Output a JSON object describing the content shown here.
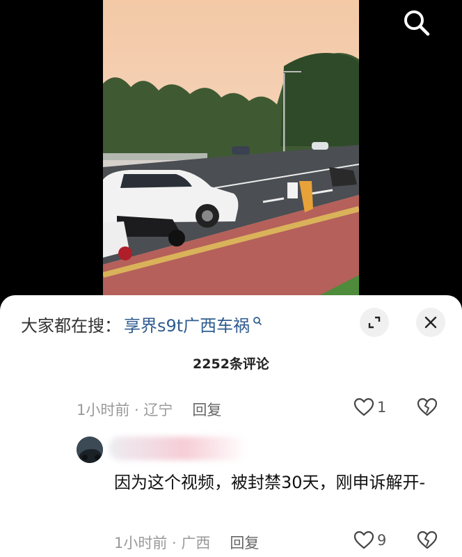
{
  "video": {
    "icons": {
      "search": "search-icon"
    }
  },
  "sheet": {
    "suggest_prefix": "大家都在搜：",
    "suggest_keyword": "享界s9t广西车祸",
    "comment_count": "2252条评论",
    "icons": {
      "expand": "expand-icon",
      "close": "close-icon"
    }
  },
  "comments": [
    {
      "time": "1小时前 · 辽宁",
      "reply_label": "回复",
      "likes": "1"
    },
    {
      "time": "1小时前 · 广西",
      "reply_label": "回复",
      "likes": "9",
      "text": "因为这个视频，被封禁30天，刚申诉解开-"
    }
  ],
  "colors": {
    "keyword": "#2f5c8f",
    "sheet_bg": "#ffffff",
    "video_bg": "#000000"
  }
}
